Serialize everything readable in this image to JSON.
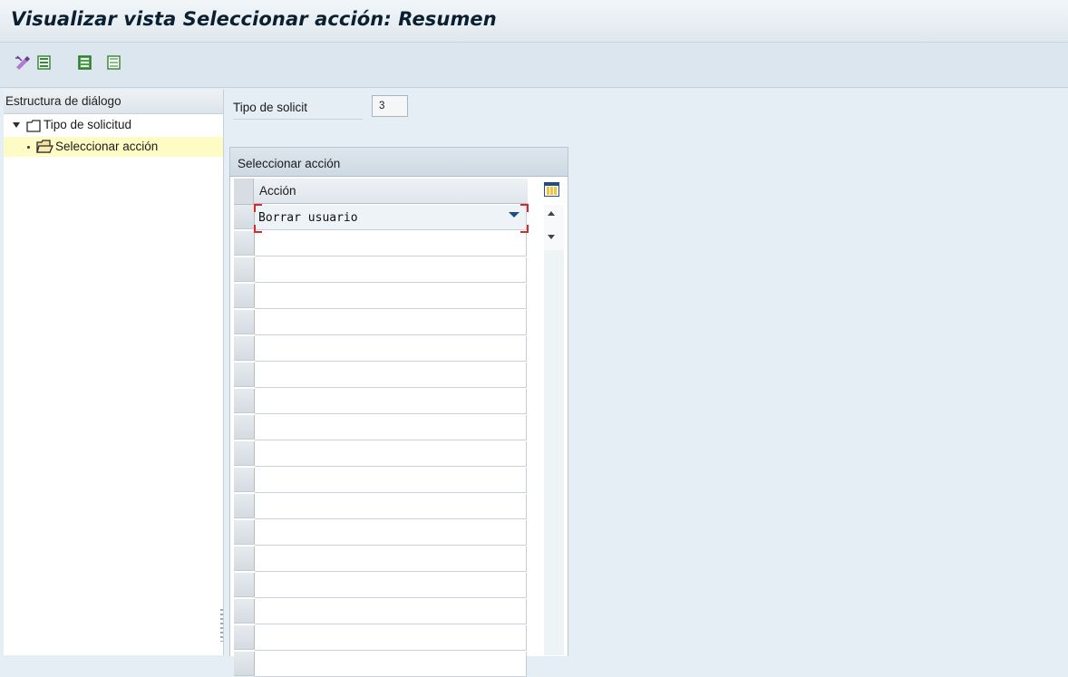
{
  "window": {
    "title": "Visualizar vista Seleccionar acción: Resumen"
  },
  "toolbar": {
    "buttons": [
      {
        "icon": "display-change-icon"
      },
      {
        "icon": "variant-icon"
      },
      {
        "icon": "select-all-icon"
      },
      {
        "icon": "deselect-icon"
      }
    ]
  },
  "dialog_structure": {
    "header": "Estructura de diálogo",
    "items": [
      {
        "label": "Tipo de solicitud",
        "icon": "folder-icon",
        "expanded": true
      },
      {
        "label": "Seleccionar acción",
        "icon": "open-folder-icon",
        "selected": true
      }
    ]
  },
  "form": {
    "field_label": "Tipo de solicit",
    "field_value": "3"
  },
  "table": {
    "title": "Seleccionar acción",
    "column_header": "Acción",
    "rows": [
      "Borrar usuario",
      "",
      "",
      "",
      "",
      "",
      "",
      "",
      "",
      "",
      "",
      "",
      "",
      "",
      "",
      "",
      "",
      "",
      ""
    ]
  },
  "colors": {
    "background": "#e5eef5",
    "title_text": "#0c1f30",
    "selection_highlight": "#fefcc4",
    "required_marker": "#d52a2a",
    "dropdown_arrow": "#1b4f82"
  }
}
